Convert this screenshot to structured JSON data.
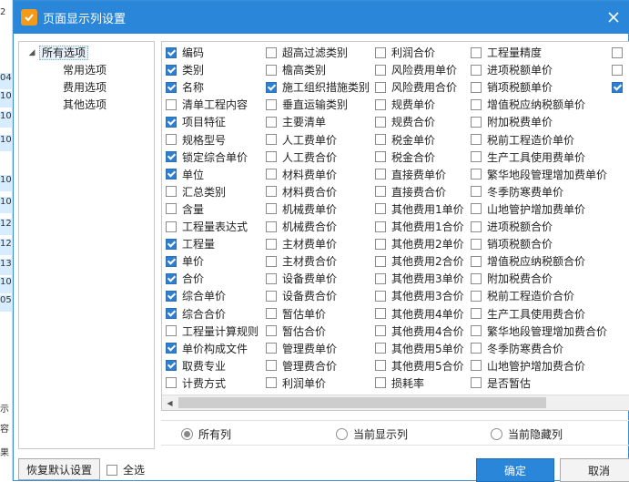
{
  "background": {
    "rows": [
      "2",
      "04",
      "10",
      "10",
      "10",
      "10",
      "10",
      "12",
      "12",
      "13",
      "10",
      "05",
      "示",
      "容",
      "果"
    ]
  },
  "dialog": {
    "title": "页面显示列设置",
    "title_icon": "app-logo-icon",
    "close_icon": "close-icon",
    "accent": "#2a86d9"
  },
  "tree": {
    "root": "所有选项",
    "children": [
      "常用选项",
      "费用选项",
      "其他选项"
    ]
  },
  "columns": [
    [
      {
        "label": "编码",
        "checked": true
      },
      {
        "label": "类别",
        "checked": true
      },
      {
        "label": "名称",
        "checked": true
      },
      {
        "label": "清单工程内容",
        "checked": false
      },
      {
        "label": "项目特征",
        "checked": true
      },
      {
        "label": "规格型号",
        "checked": false
      },
      {
        "label": "锁定综合单价",
        "checked": true
      },
      {
        "label": "单位",
        "checked": true
      },
      {
        "label": "汇总类别",
        "checked": false
      },
      {
        "label": "含量",
        "checked": false
      },
      {
        "label": "工程量表达式",
        "checked": false
      },
      {
        "label": "工程量",
        "checked": true
      },
      {
        "label": "单价",
        "checked": true
      },
      {
        "label": "合价",
        "checked": true
      },
      {
        "label": "综合单价",
        "checked": true
      },
      {
        "label": "综合合价",
        "checked": true
      },
      {
        "label": "工程量计算规则",
        "checked": false
      },
      {
        "label": "单价构成文件",
        "checked": true
      },
      {
        "label": "取费专业",
        "checked": true
      },
      {
        "label": "计费方式",
        "checked": false
      }
    ],
    [
      {
        "label": "超高过滤类别",
        "checked": false
      },
      {
        "label": "檐高类别",
        "checked": false
      },
      {
        "label": "施工组织措施类别",
        "checked": true
      },
      {
        "label": "垂直运输类别",
        "checked": false
      },
      {
        "label": "主要清单",
        "checked": false
      },
      {
        "label": "人工费单价",
        "checked": false
      },
      {
        "label": "人工费合价",
        "checked": false
      },
      {
        "label": "材料费单价",
        "checked": false
      },
      {
        "label": "材料费合价",
        "checked": false
      },
      {
        "label": "机械费单价",
        "checked": false
      },
      {
        "label": "机械费合价",
        "checked": false
      },
      {
        "label": "主材费单价",
        "checked": false
      },
      {
        "label": "主材费合价",
        "checked": false
      },
      {
        "label": "设备费单价",
        "checked": false
      },
      {
        "label": "设备费合价",
        "checked": false
      },
      {
        "label": "暂估单价",
        "checked": false
      },
      {
        "label": "暂估合价",
        "checked": false
      },
      {
        "label": "管理费单价",
        "checked": false
      },
      {
        "label": "管理费合价",
        "checked": false
      },
      {
        "label": "利润单价",
        "checked": false
      }
    ],
    [
      {
        "label": "利润合价",
        "checked": false
      },
      {
        "label": "风险费用单价",
        "checked": false
      },
      {
        "label": "风险费用合价",
        "checked": false
      },
      {
        "label": "规费单价",
        "checked": false
      },
      {
        "label": "规费合价",
        "checked": false
      },
      {
        "label": "税金单价",
        "checked": false
      },
      {
        "label": "税金合价",
        "checked": false
      },
      {
        "label": "直接费单价",
        "checked": false
      },
      {
        "label": "直接费合价",
        "checked": false
      },
      {
        "label": "其他费用1单价",
        "checked": false
      },
      {
        "label": "其他费用1合价",
        "checked": false
      },
      {
        "label": "其他费用2单价",
        "checked": false
      },
      {
        "label": "其他费用2合价",
        "checked": false
      },
      {
        "label": "其他费用3单价",
        "checked": false
      },
      {
        "label": "其他费用3合价",
        "checked": false
      },
      {
        "label": "其他费用4单价",
        "checked": false
      },
      {
        "label": "其他费用4合价",
        "checked": false
      },
      {
        "label": "其他费用5单价",
        "checked": false
      },
      {
        "label": "其他费用5合价",
        "checked": false
      },
      {
        "label": "损耗率",
        "checked": false
      }
    ],
    [
      {
        "label": "工程量精度",
        "checked": false
      },
      {
        "label": "进项税额单价",
        "checked": false
      },
      {
        "label": "销项税额单价",
        "checked": false
      },
      {
        "label": "增值税应纳税额单价",
        "checked": false
      },
      {
        "label": "附加税费单价",
        "checked": false
      },
      {
        "label": "税前工程造价单价",
        "checked": false
      },
      {
        "label": "生产工具使用费单价",
        "checked": false
      },
      {
        "label": "繁华地段管理增加费单价",
        "checked": false
      },
      {
        "label": "冬季防寒费单价",
        "checked": false
      },
      {
        "label": "山地管护增加费单价",
        "checked": false
      },
      {
        "label": "进项税额合价",
        "checked": false
      },
      {
        "label": "销项税额合价",
        "checked": false
      },
      {
        "label": "增值税应纳税额合价",
        "checked": false
      },
      {
        "label": "附加税费合价",
        "checked": false
      },
      {
        "label": "税前工程造价合价",
        "checked": false
      },
      {
        "label": "生产工具使用费合价",
        "checked": false
      },
      {
        "label": "繁华地段管理增加费合价",
        "checked": false
      },
      {
        "label": "冬季防寒费合价",
        "checked": false
      },
      {
        "label": "山地管护增加费合价",
        "checked": false
      },
      {
        "label": "是否暂估",
        "checked": false
      }
    ],
    [
      {
        "label": "",
        "checked": false
      },
      {
        "label": "",
        "checked": false
      },
      {
        "label": "",
        "checked": true
      }
    ]
  ],
  "radios": [
    {
      "label": "所有列",
      "selected": true
    },
    {
      "label": "当前显示列",
      "selected": false
    },
    {
      "label": "当前隐藏列",
      "selected": false
    }
  ],
  "buttons": {
    "reset": "恢复默认设置",
    "select_all": "全选",
    "ok": "确定",
    "cancel": "取消"
  }
}
